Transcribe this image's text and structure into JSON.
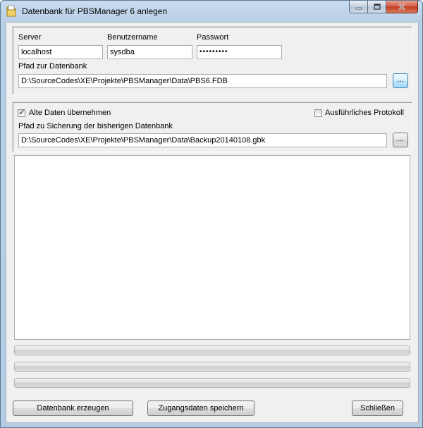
{
  "window": {
    "title": "Datenbank für PBSManager 6 anlegen",
    "icon": "database-folder-icon"
  },
  "connection": {
    "server_label": "Server",
    "server_value": "localhost",
    "user_label": "Benutzername",
    "user_value": "sysdba",
    "password_label": "Passwort",
    "password_value": "•••••••••",
    "db_path_label": "Pfad zur Datenbank",
    "db_path_value": "D:\\SourceCodes\\XE\\Projekte\\PBSManager\\Data\\PBS6.FDB",
    "browse_label": "..."
  },
  "backup": {
    "keep_data_label": "Alte Daten übernehmen",
    "keep_data_checked": true,
    "verbose_label": "Ausführliches Protokoll",
    "verbose_checked": false,
    "backup_path_label": "Pfad zu Sicherung der bisherigen Datenbank",
    "backup_path_value": "D:\\SourceCodes\\XE\\Projekte\\PBSManager\\Data\\Backup20140108.gbk",
    "browse_label": "..."
  },
  "progress": [
    0,
    0,
    0
  ],
  "buttons": {
    "create": "Datenbank erzeugen",
    "save": "Zugangsdaten speichern",
    "close": "Schließen"
  }
}
